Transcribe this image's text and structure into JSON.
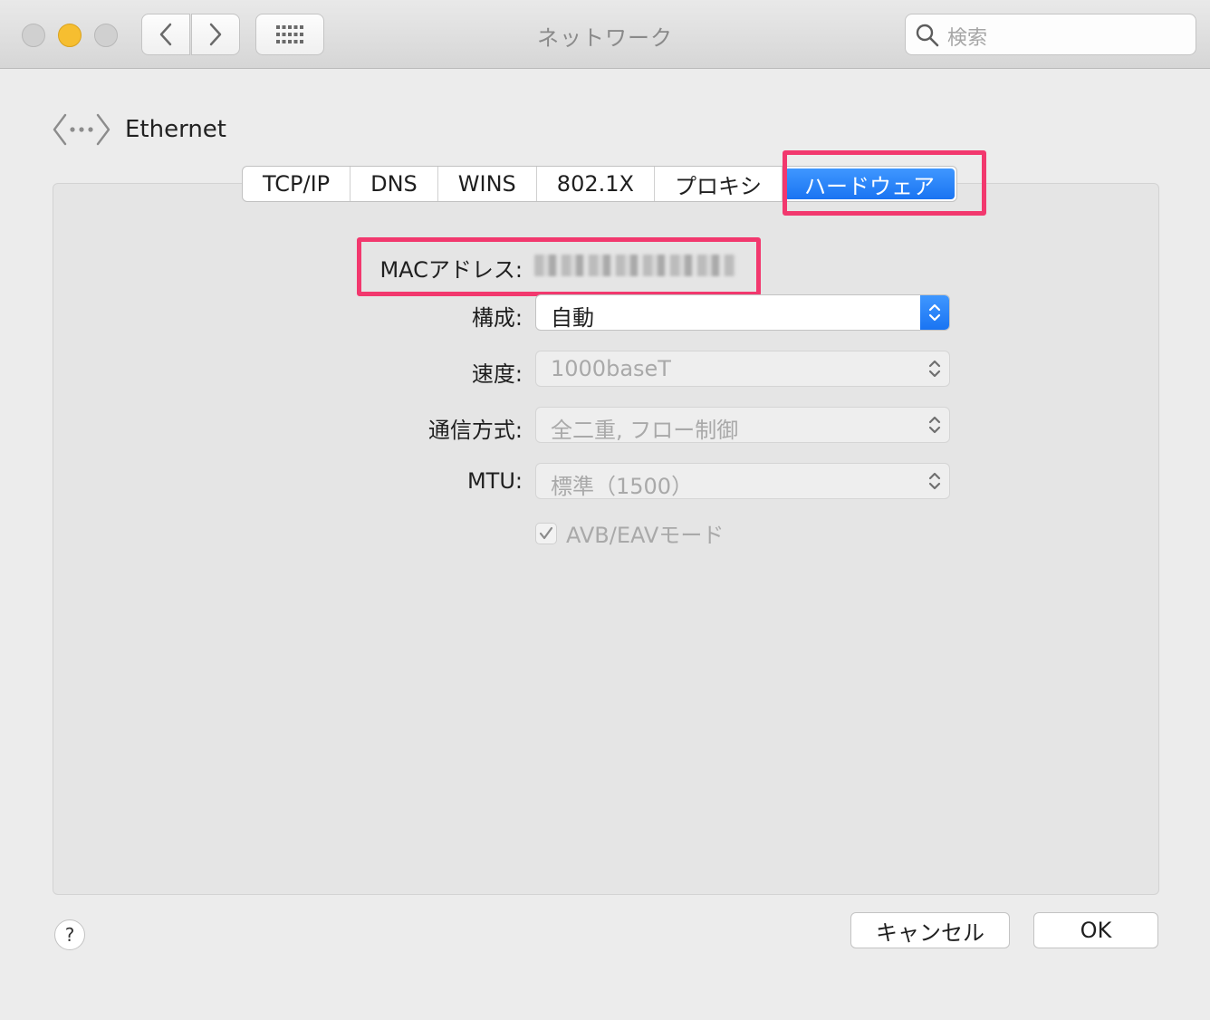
{
  "window": {
    "title": "ネットワーク",
    "search_placeholder": "検索"
  },
  "service": {
    "name": "Ethernet",
    "icon": "ethernet-icon"
  },
  "tabs": [
    {
      "label": "TCP/IP",
      "selected": false
    },
    {
      "label": "DNS",
      "selected": false
    },
    {
      "label": "WINS",
      "selected": false
    },
    {
      "label": "802.1X",
      "selected": false
    },
    {
      "label": "プロキシ",
      "selected": false
    },
    {
      "label": "ハードウェア",
      "selected": true
    }
  ],
  "hardware": {
    "mac_label": "MACアドレス:",
    "mac_value": "",
    "config_label": "構成:",
    "config_value": "自動",
    "speed_label": "速度:",
    "speed_value": "1000baseT",
    "duplex_label": "通信方式:",
    "duplex_value": "全二重, フロー制御",
    "mtu_label": "MTU:",
    "mtu_value": "標準（1500）",
    "avb_label": "AVB/EAVモード",
    "avb_checked": true
  },
  "footer": {
    "help_label": "?",
    "cancel_label": "キャンセル",
    "ok_label": "OK"
  },
  "colors": {
    "accent": "#1a74f2",
    "highlight": "#f2386e"
  }
}
